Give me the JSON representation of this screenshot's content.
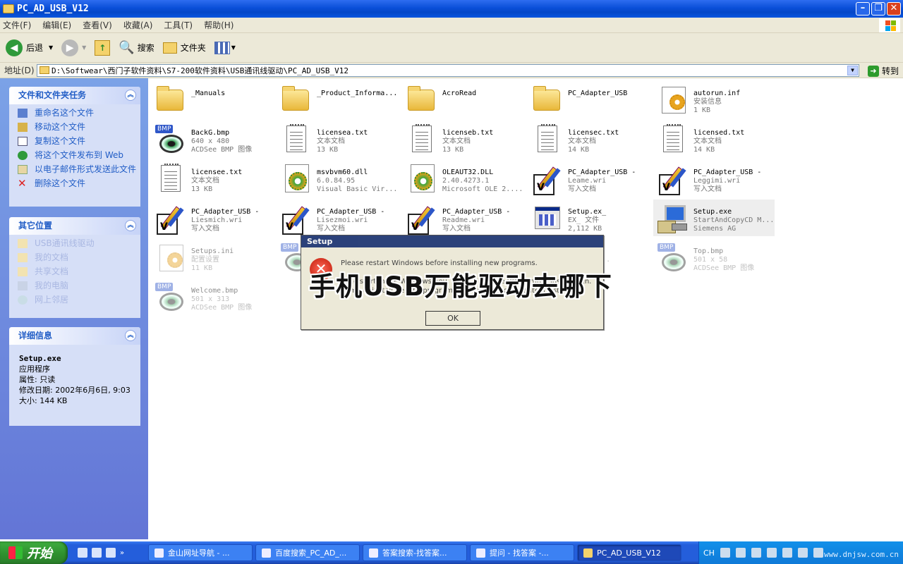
{
  "window": {
    "title": "PC_AD_USB_V12"
  },
  "menu": [
    "文件(F)",
    "编辑(E)",
    "查看(V)",
    "收藏(A)",
    "工具(T)",
    "帮助(H)"
  ],
  "toolbar": {
    "back": "后退",
    "search": "搜索",
    "folders": "文件夹"
  },
  "address": {
    "label": "地址(D)",
    "path": "D:\\Softwear\\西门子软件资料\\S7-200软件资料\\USB通讯线驱动\\PC_AD_USB_V12",
    "go": "转到"
  },
  "tasks_panel": {
    "title": "文件和文件夹任务",
    "items": [
      "重命名这个文件",
      "移动这个文件",
      "复制这个文件",
      "将这个文件发布到 Web",
      "以电子邮件形式发送此文件",
      "删除这个文件"
    ]
  },
  "places_panel": {
    "title": "其它位置",
    "items": [
      "USB通讯线驱动",
      "我的文档",
      "共享文档",
      "我的电脑",
      "网上邻居"
    ]
  },
  "details_panel": {
    "title": "详细信息",
    "name": "Setup.exe",
    "type": "应用程序",
    "attr": "属性: 只读",
    "modified": "修改日期: 2002年6月6日, 9:03",
    "size": "大小: 144 KB"
  },
  "files": [
    {
      "name": "_Manuals",
      "l2": "",
      "l3": "",
      "icon": "folder-icon"
    },
    {
      "name": "_Product_Informa...",
      "l2": "",
      "l3": "",
      "icon": "folder-icon"
    },
    {
      "name": "AcroRead",
      "l2": "",
      "l3": "",
      "icon": "folder-icon"
    },
    {
      "name": "PC_Adapter_USB",
      "l2": "",
      "l3": "",
      "icon": "folder-icon"
    },
    {
      "name": "autorun.inf",
      "l2": "安装信息",
      "l3": "1 KB",
      "icon": "settings-file-icon"
    },
    {
      "name": "BackG.bmp",
      "l2": "640 x 480",
      "l3": "ACDSee BMP 图像",
      "icon": "bmp-image-icon"
    },
    {
      "name": "licensea.txt",
      "l2": "文本文档",
      "l3": "13 KB",
      "icon": "text-file-icon"
    },
    {
      "name": "licenseb.txt",
      "l2": "文本文档",
      "l3": "13 KB",
      "icon": "text-file-icon"
    },
    {
      "name": "licensec.txt",
      "l2": "文本文档",
      "l3": "14 KB",
      "icon": "text-file-icon"
    },
    {
      "name": "licensed.txt",
      "l2": "文本文档",
      "l3": "14 KB",
      "icon": "text-file-icon"
    },
    {
      "name": "licensee.txt",
      "l2": "文本文档",
      "l3": "13 KB",
      "icon": "text-file-icon"
    },
    {
      "name": "msvbvm60.dll",
      "l2": "6.0.84.95",
      "l3": "Visual Basic Vir...",
      "icon": "dll-file-icon"
    },
    {
      "name": "OLEAUT32.DLL",
      "l2": "2.40.4273.1",
      "l3": "Microsoft OLE 2....",
      "icon": "dll-file-icon"
    },
    {
      "name": "PC_Adapter_USB -",
      "l2": "Leame.wri",
      "l3": "写入文档",
      "icon": "write-doc-icon"
    },
    {
      "name": "PC_Adapter_USB -",
      "l2": "Leggimi.wri",
      "l3": "写入文档",
      "icon": "write-doc-icon"
    },
    {
      "name": "PC_Adapter_USB -",
      "l2": "Liesmich.wri",
      "l3": "写入文档",
      "icon": "write-doc-icon"
    },
    {
      "name": "PC_Adapter_USB -",
      "l2": "Lisezmoi.wri",
      "l3": "写入文档",
      "icon": "write-doc-icon"
    },
    {
      "name": "PC_Adapter_USB -",
      "l2": "Readme.wri",
      "l3": "写入文档",
      "icon": "write-doc-icon"
    },
    {
      "name": "Setup.ex_",
      "l2": "EX_ 文件",
      "l3": "2,112 KB",
      "icon": "exe-file-icon"
    },
    {
      "name": "Setup.exe",
      "l2": "StartAndCopyCD M...",
      "l3": "Siemens AG",
      "icon": "installer-icon"
    },
    {
      "name": "Setups.ini",
      "l2": "配置设置",
      "l3": "11 KB",
      "icon": "settings-file-icon"
    },
    {
      "name": "",
      "l2": "",
      "l3": "",
      "icon": "bmp-image-icon"
    },
    {
      "name": "",
      "l2": "",
      "l3": "",
      "icon": "none"
    },
    {
      "name": "exe",
      "l2": "evices ...",
      "l3": "G",
      "icon": "none"
    },
    {
      "name": "Top.bmp",
      "l2": "501 x 58",
      "l3": "ACDSee BMP 图像",
      "icon": "bmp-image-icon"
    },
    {
      "name": "Welcome.bmp",
      "l2": "501 x 313",
      "l3": "ACDSee BMP 图像",
      "icon": "bmp-image-icon"
    }
  ],
  "dialog": {
    "title": "Setup",
    "lines": [
      "Please restart Windows before installing new programs.",
      "",
      "Bitte starten Sie Windows neu, bevor Sie neue Programme installieren.",
      "Prima di installare altri programmi, avviare nuovamente il sistema."
    ],
    "ok": "OK"
  },
  "overlay_text": "手机USB万能驱动去哪下",
  "taskbar": {
    "start": "开始",
    "tasks": [
      "金山网址导航 - ...",
      "百度搜索_PC_AD_...",
      "答案搜索-找答案...",
      "提问 - 找答案 -...",
      "PC_AD_USB_V12"
    ],
    "tray_lang": "CH",
    "watermark": "www.dnjsw.com.cn"
  }
}
